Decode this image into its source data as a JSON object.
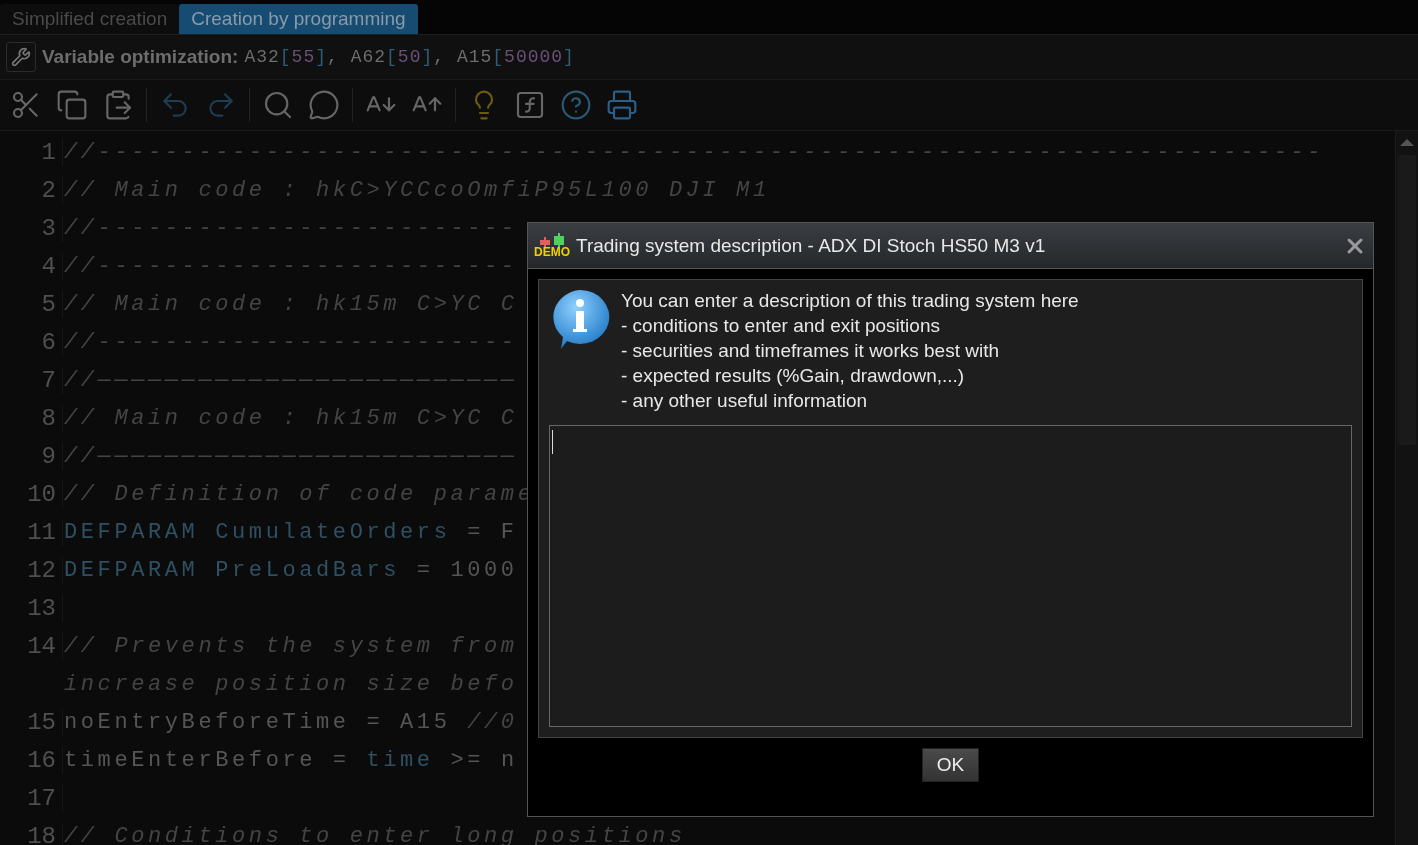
{
  "tabs": [
    {
      "label": "Simplified creation",
      "selected": false
    },
    {
      "label": "Creation by programming",
      "selected": true
    }
  ],
  "optimization": {
    "label": "Variable optimization:",
    "segments": [
      {
        "text": "A32",
        "kind": "name"
      },
      {
        "text": "[",
        "kind": "bracket"
      },
      {
        "text": "55",
        "kind": "number"
      },
      {
        "text": "]",
        "kind": "bracket"
      },
      {
        "text": ", ",
        "kind": "name"
      },
      {
        "text": "A62",
        "kind": "name"
      },
      {
        "text": "[",
        "kind": "bracket"
      },
      {
        "text": "50",
        "kind": "number"
      },
      {
        "text": "]",
        "kind": "bracket"
      },
      {
        "text": ", ",
        "kind": "name"
      },
      {
        "text": "A15",
        "kind": "name"
      },
      {
        "text": "[",
        "kind": "bracket"
      },
      {
        "text": "50000",
        "kind": "number"
      },
      {
        "text": "]",
        "kind": "bracket"
      }
    ]
  },
  "toolbar": [
    {
      "kind": "cut"
    },
    {
      "kind": "copy"
    },
    {
      "kind": "paste"
    },
    {
      "kind": "sep"
    },
    {
      "kind": "undo"
    },
    {
      "kind": "redo"
    },
    {
      "kind": "sep"
    },
    {
      "kind": "search"
    },
    {
      "kind": "comment"
    },
    {
      "kind": "sep"
    },
    {
      "kind": "font-down"
    },
    {
      "kind": "font-up"
    },
    {
      "kind": "sep"
    },
    {
      "kind": "idea"
    },
    {
      "kind": "function"
    },
    {
      "kind": "help"
    },
    {
      "kind": "print"
    }
  ],
  "editor": {
    "lines": [
      {
        "number": "1",
        "segments": [
          {
            "text": "//-------------------------------------------------------------------------",
            "kind": "comment"
          }
        ]
      },
      {
        "number": "2",
        "segments": [
          {
            "text": "// Main code : hkC>YCCcoOmfiP95L100 DJI M1",
            "kind": "comment"
          }
        ]
      },
      {
        "number": "3",
        "segments": [
          {
            "text": "//-------------------------",
            "kind": "comment"
          }
        ]
      },
      {
        "number": "4",
        "segments": [
          {
            "text": "//-------------------------",
            "kind": "comment"
          }
        ]
      },
      {
        "number": "5",
        "segments": [
          {
            "text": "// Main code : hk15m C>YC C",
            "kind": "comment"
          }
        ]
      },
      {
        "number": "6",
        "segments": [
          {
            "text": "//-------------------------",
            "kind": "comment"
          }
        ]
      },
      {
        "number": "7",
        "segments": [
          {
            "text": "//—————————————————————————",
            "kind": "comment"
          }
        ]
      },
      {
        "number": "8",
        "segments": [
          {
            "text": "// Main code : hk15m C>YC C",
            "kind": "comment"
          }
        ]
      },
      {
        "number": "9",
        "segments": [
          {
            "text": "//—————————————————————————",
            "kind": "comment"
          }
        ]
      },
      {
        "number": "10",
        "segments": [
          {
            "text": "// Definition of code parame",
            "kind": "comment"
          }
        ]
      },
      {
        "number": "11",
        "segments": [
          {
            "text": "DEFPARAM CumulateOrders",
            "kind": "keyword"
          },
          {
            "text": " = F",
            "kind": "plain"
          }
        ]
      },
      {
        "number": "12",
        "segments": [
          {
            "text": "DEFPARAM PreLoadBars",
            "kind": "keyword"
          },
          {
            "text": " = 1000",
            "kind": "plain"
          }
        ]
      },
      {
        "number": "13"
      },
      {
        "number": "14",
        "segments": [
          {
            "text": "// Prevents the system from",
            "kind": "comment"
          }
        ]
      },
      {
        "segments": [
          {
            "text": "increase position size befo",
            "kind": "comment"
          }
        ]
      },
      {
        "number": "15",
        "segments": [
          {
            "text": "noEntryBeforeTime = A15 ",
            "kind": "plain"
          },
          {
            "text": "//0",
            "kind": "comment"
          }
        ]
      },
      {
        "number": "16",
        "segments": [
          {
            "text": "timeEnterBefore = ",
            "kind": "plain"
          },
          {
            "text": "time",
            "kind": "keyword"
          },
          {
            "text": " >= n",
            "kind": "plain"
          }
        ]
      },
      {
        "number": "17"
      },
      {
        "number": "18",
        "segments": [
          {
            "text": "// Conditions to enter long positions",
            "kind": "comment"
          }
        ]
      }
    ]
  },
  "dialog": {
    "badge": "DEMO",
    "title": "Trading system description - ADX DI Stoch HS50 M3 v1",
    "message": [
      "You can enter a description of this trading system here",
      "- conditions to enter and exit positions",
      "- securities and timeframes it works best with",
      "- expected results (%Gain, drawdown,...)",
      "- any other useful information"
    ],
    "button": "OK"
  }
}
